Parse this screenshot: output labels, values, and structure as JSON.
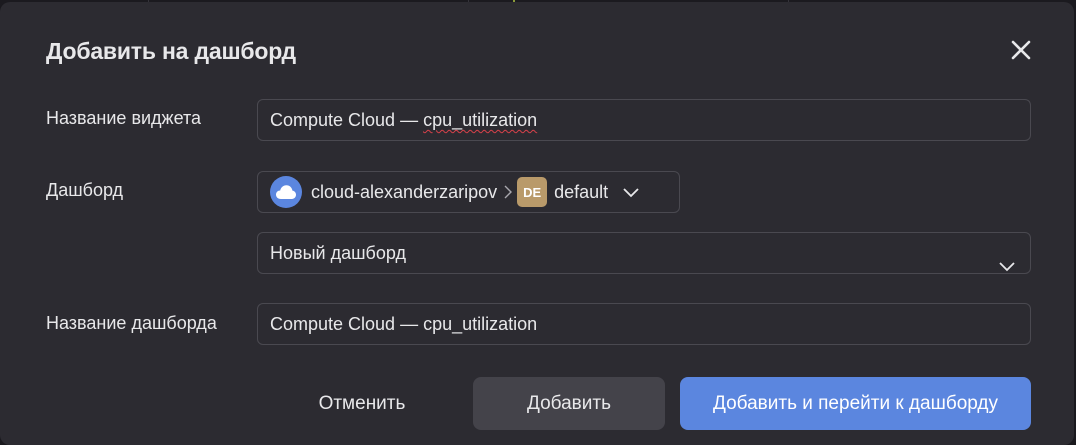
{
  "dialog": {
    "title": "Добавить на дашборд",
    "close_icon": "close-icon"
  },
  "widget_name": {
    "label": "Название виджета",
    "value_prefix": "Compute Cloud — ",
    "value_misspelled": "cpu_utilization"
  },
  "dashboard": {
    "label": "Дашборд",
    "cloud": "cloud-alexanderzaripov",
    "cloud_icon": "cloud-icon",
    "separator_icon": "chevron-right-icon",
    "folder_badge": "DE",
    "folder": "default",
    "folder_badge_color": "#b99a6a",
    "dropdown_icon": "chevron-down-icon",
    "selected": "Новый дашборд"
  },
  "dashboard_name": {
    "label": "Название дашборда",
    "value": "Compute Cloud — cpu_utilization"
  },
  "actions": {
    "cancel": "Отменить",
    "add": "Добавить",
    "add_and_go": "Добавить и перейти к дашборду"
  },
  "colors": {
    "dialog_bg": "#2c2b31",
    "primary": "#5b86df",
    "secondary_button": "#44434a",
    "spellcheck_underline": "#d9414a"
  }
}
